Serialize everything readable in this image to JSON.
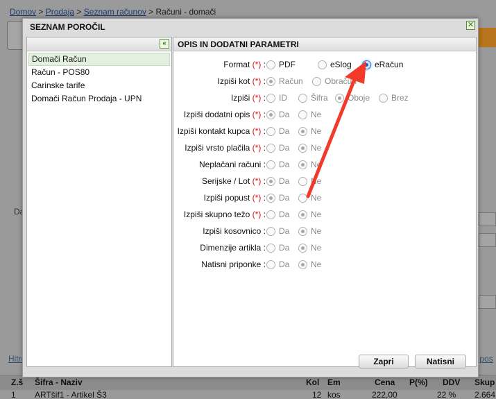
{
  "background": {
    "breadcrumb": [
      {
        "label": "Domov",
        "link": true
      },
      {
        "label": "Prodaja",
        "link": true
      },
      {
        "label": "Seznam računov",
        "link": true
      },
      {
        "label": "Računi - domači",
        "link": false
      }
    ],
    "left_label": "Da",
    "link_bottom": "Hitro podjetnje",
    "link_right": "odi pos",
    "table": {
      "headers": [
        "Z.š",
        "Šifra - Naziv",
        "Kol",
        "Em",
        "Cena",
        "P(%)",
        "DDV",
        "Skup"
      ],
      "row": [
        "1",
        "ARTšif1 - Artikel Š3",
        "12",
        "kos",
        "222,00",
        "",
        "22 %",
        "2.664"
      ]
    }
  },
  "dialog": {
    "title": "SEZNAM POROČIL",
    "close_icon": "close-icon",
    "left_panel": {
      "collapse_label": "«",
      "reports": [
        "Domači Račun",
        "Račun - POS80",
        "Carinske tarife",
        "Domači Račun Prodaja - UPN"
      ],
      "selected_index": 0
    },
    "right_panel": {
      "title": "OPIS IN DODATNI PARAMETRI",
      "params": [
        {
          "label": "Format",
          "required": "(*)",
          "suffix": " :",
          "options": [
            "PDF",
            "eSlog",
            "eRačun"
          ],
          "selected": 2
        },
        {
          "label": "Izpiši kot",
          "required": "(*)",
          "suffix": " :",
          "options": [
            "Račun",
            "Obračun"
          ],
          "selected": 0
        },
        {
          "label": "Izpiši",
          "required": "(*)",
          "suffix": " :",
          "options": [
            "ID",
            "Šifra",
            "Oboje",
            "Brez"
          ],
          "selected": 2
        },
        {
          "label": "Izpiši dodatni opis",
          "required": "(*)",
          "suffix": " :",
          "options": [
            "Da",
            "Ne"
          ],
          "selected": 0
        },
        {
          "label": "Izpiši kontakt kupca",
          "required": "(*)",
          "suffix": " :",
          "options": [
            "Da",
            "Ne"
          ],
          "selected": 1
        },
        {
          "label": "Izpiši vrsto plačila",
          "required": "(*)",
          "suffix": " :",
          "options": [
            "Da",
            "Ne"
          ],
          "selected": 1
        },
        {
          "label": "Neplačani računi",
          "required": "",
          "suffix": " :",
          "options": [
            "Da",
            "Ne"
          ],
          "selected": 1
        },
        {
          "label": "Serijske / Lot",
          "required": "(*)",
          "suffix": " :",
          "options": [
            "Da",
            "Ne"
          ],
          "selected": 0
        },
        {
          "label": "Izpiši popust",
          "required": "(*)",
          "suffix": " :",
          "options": [
            "Da",
            "Ne"
          ],
          "selected": 0
        },
        {
          "label": "Izpiši skupno težo",
          "required": "(*)",
          "suffix": " :",
          "options": [
            "Da",
            "Ne"
          ],
          "selected": 1
        },
        {
          "label": "Izpiši kosovnico",
          "required": "",
          "suffix": " :",
          "options": [
            "Da",
            "Ne"
          ],
          "selected": 1
        },
        {
          "label": "Dimenzije artikla",
          "required": "",
          "suffix": " :",
          "options": [
            "Da",
            "Ne"
          ],
          "selected": 1
        },
        {
          "label": "Natisni priponke",
          "required": "",
          "suffix": " :",
          "options": [
            "Da",
            "Ne"
          ],
          "selected": 1
        }
      ]
    },
    "buttons": {
      "print_preview": "Zapri",
      "print": "Natisni"
    }
  },
  "colors": {
    "required": "#dd1111",
    "arrow": "#f23a2a",
    "accent": "#2a74d8"
  }
}
